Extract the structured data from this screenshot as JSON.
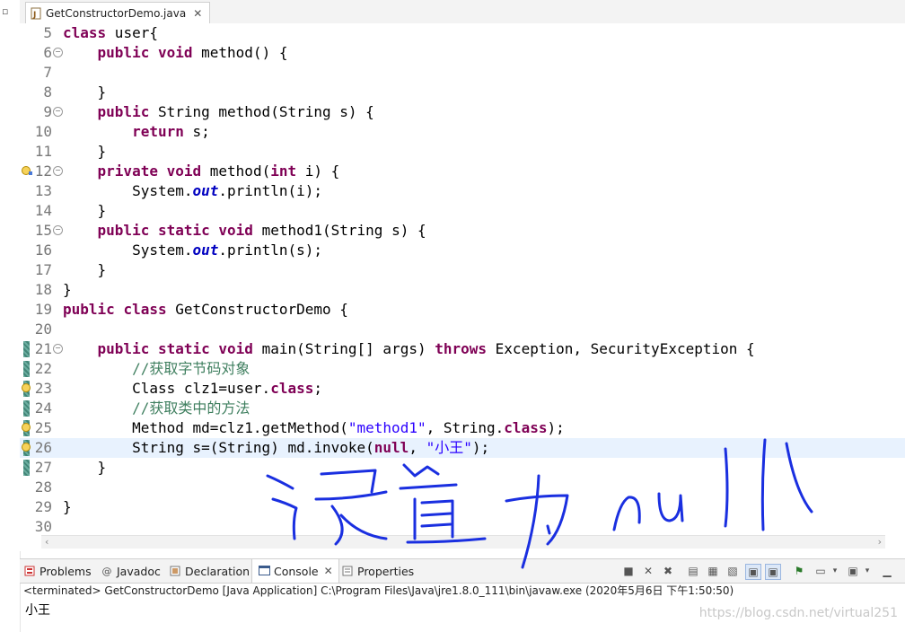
{
  "editor_tab": {
    "title": "GetConstructorDemo.java",
    "close": "✕"
  },
  "lines": [
    {
      "n": "5",
      "code": "class user{"
    },
    {
      "n": "6",
      "code": "    public void method() {"
    },
    {
      "n": "7",
      "code": ""
    },
    {
      "n": "8",
      "code": "    }"
    },
    {
      "n": "9",
      "code": "    public String method(String s) {"
    },
    {
      "n": "10",
      "code": "        return s;"
    },
    {
      "n": "11",
      "code": "    }"
    },
    {
      "n": "12",
      "code": "    private void method(int i) {"
    },
    {
      "n": "13",
      "code": "        System.out.println(i);"
    },
    {
      "n": "14",
      "code": "    }"
    },
    {
      "n": "15",
      "code": "    public static void method1(String s) {"
    },
    {
      "n": "16",
      "code": "        System.out.println(s);"
    },
    {
      "n": "17",
      "code": "    }"
    },
    {
      "n": "18",
      "code": "}"
    },
    {
      "n": "19",
      "code": "public class GetConstructorDemo {"
    },
    {
      "n": "20",
      "code": ""
    },
    {
      "n": "21",
      "code": "    public static void main(String[] args) throws Exception, SecurityException {"
    },
    {
      "n": "22",
      "code": "        //获取字节码对象"
    },
    {
      "n": "23",
      "code": "        Class clz1=user.class;"
    },
    {
      "n": "24",
      "code": "        //获取类中的方法"
    },
    {
      "n": "25",
      "code": "        Method md=clz1.getMethod(\"method1\", String.class);"
    },
    {
      "n": "26",
      "code": "        String s=(String) md.invoke(null, \"小王\");"
    },
    {
      "n": "27",
      "code": "    }"
    },
    {
      "n": "28",
      "code": ""
    },
    {
      "n": "29",
      "code": "}"
    },
    {
      "n": "30",
      "code": ""
    }
  ],
  "panel_tabs": {
    "problems": "Problems",
    "javadoc": "Javadoc",
    "declaration": "Declaration",
    "console": "Console",
    "properties": "Properties"
  },
  "console": {
    "header": "<terminated> GetConstructorDemo [Java Application] C:\\Program Files\\Java\\jre1.8.0_111\\bin\\javaw.exe (2020年5月6日 下午1:50:50)",
    "output": "小王"
  },
  "watermark": "https://blog.csdn.net/virtual251",
  "colors": {
    "keyword": "#7f0055",
    "string": "#2a00ff",
    "comment": "#3f7f5f",
    "handwriting": "#1a2fe0"
  }
}
